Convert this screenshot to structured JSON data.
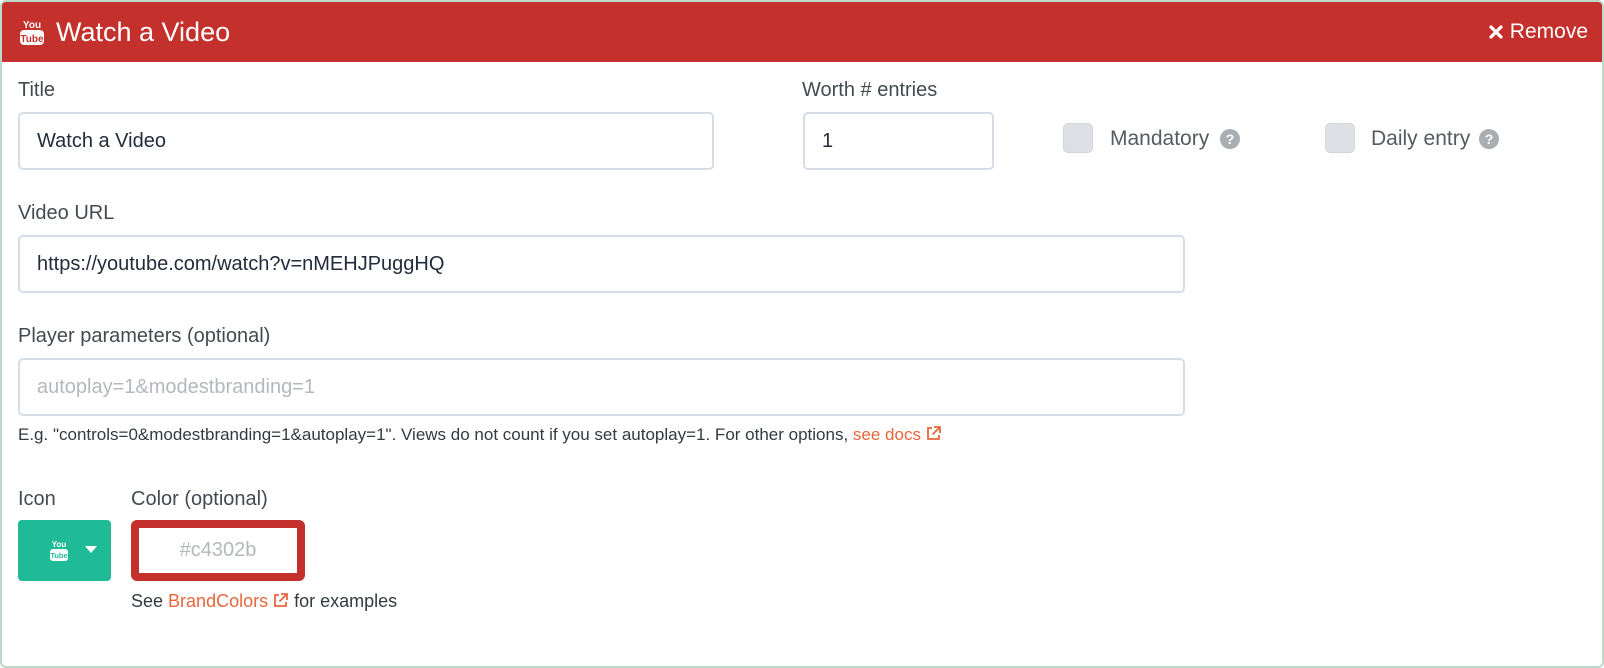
{
  "header": {
    "title": "Watch a Video",
    "remove_label": "Remove",
    "background_color": "#c4302b",
    "logo_icon": "youtube-icon"
  },
  "form": {
    "title_label": "Title",
    "title_value": "Watch a Video",
    "worth_label": "Worth # entries",
    "worth_value": "1",
    "mandatory_label": "Mandatory",
    "mandatory_checked": false,
    "daily_entry_label": "Daily entry",
    "daily_entry_checked": false,
    "video_url_label": "Video URL",
    "video_url_value": "https://youtube.com/watch?v=nMEHJPuggHQ",
    "player_params_label": "Player parameters (optional)",
    "player_params_value": "",
    "player_params_placeholder": "autoplay=1&modestbranding=1",
    "help_text": "E.g. \"controls=0&modestbranding=1&autoplay=1\". Views do not count if you set autoplay=1. For other options,",
    "help_link": "see docs",
    "icon_label": "Icon",
    "icon_selected": "youtube-icon",
    "icon_button_color": "#1fbb96",
    "color_label": "Color (optional)",
    "color_value": "",
    "color_placeholder": "#c4302b",
    "brand_prefix": "See",
    "brand_link": "BrandColors",
    "brand_suffix": "for examples",
    "link_color": "#e8663c"
  }
}
